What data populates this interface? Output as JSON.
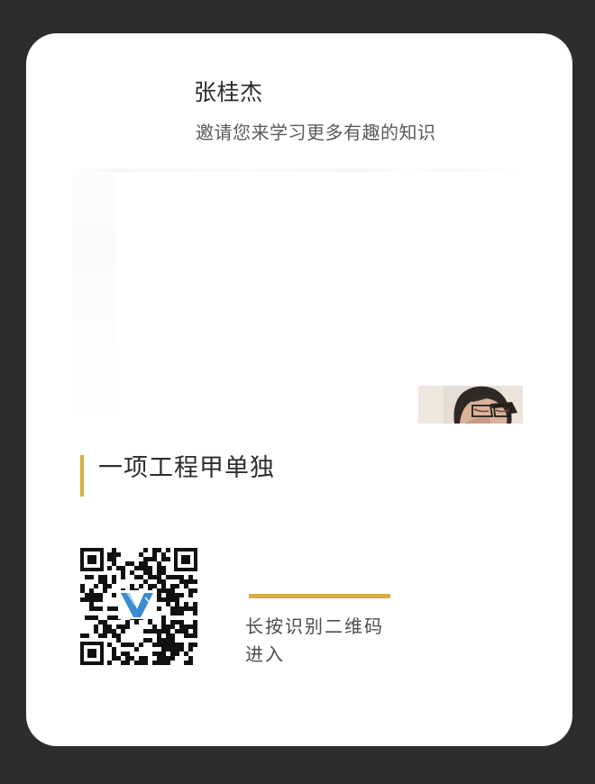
{
  "share_card": {
    "inviter_name": "张桂杰",
    "invite_message": "邀请您来学习更多有趣的知识",
    "course_title": "一项工程甲单独",
    "scan_hint": "长按识别二维码进入"
  },
  "icons": {
    "qr": "qr-code-icon",
    "logo": "v-logo-icon",
    "presenter": "presenter-photo"
  },
  "colors": {
    "background": "#2d2d2d",
    "card": "#ffffff",
    "accent": "#d9ad44",
    "logo_blue": "#3a8bd0"
  }
}
